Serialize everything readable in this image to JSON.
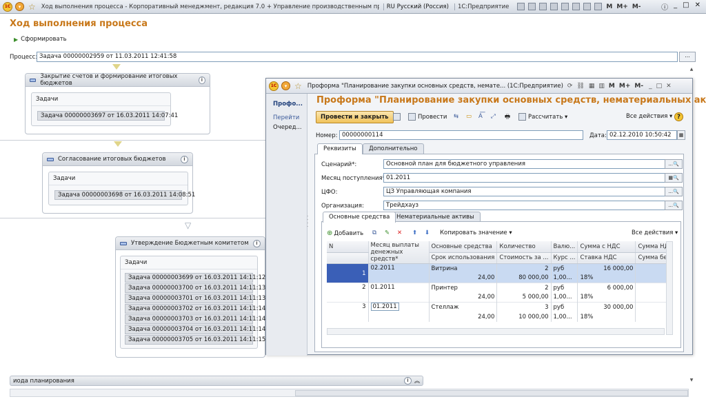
{
  "titlebar": {
    "title": "Ход выполнения процесса - Корпоративный менеджмент, редакция 7.0 + Управление производственным предприятием, ...",
    "lang": "RU Русский (Россия)",
    "app": "1С:Предприятие",
    "letters": [
      "M",
      "M+",
      "M-"
    ]
  },
  "page": {
    "title": "Ход выполнения процесса",
    "form_button": "Сформировать",
    "process_label": "Процесс:",
    "process_value": "Задача 00000002959 от 11.03.2011 12:41:58",
    "dots": "..."
  },
  "blocks": [
    {
      "title": "Закрытие счетов и формирование итоговых бюджетов",
      "tasks_label": "Задачи",
      "tasks": [
        "Задача 00000003697 от 16.03.2011 14:07:41"
      ]
    },
    {
      "title": "Согласование итоговых бюджетов",
      "tasks_label": "Задачи",
      "tasks": [
        "Задача 00000003698 от 16.03.2011 14:08:51"
      ]
    },
    {
      "title": "Утверждение Бюджетным комитетом",
      "tasks_label": "Задачи",
      "tasks": [
        "Задача 00000003699 от 16.03.2011 14:11:12",
        "Задача 00000003700 от 16.03.2011 14:11:13",
        "Задача 00000003701 от 16.03.2011 14:11:13",
        "Задача 00000003702 от 16.03.2011 14:11:14",
        "Задача 00000003703 от 16.03.2011 14:11:14",
        "Задача 00000003704 от 16.03.2011 14:11:14",
        "Задача 00000003705 от 16.03.2011 14:11:15"
      ]
    }
  ],
  "bottom_block": "иода планирования",
  "dialog": {
    "title": "Проформа \"Планирование закупки основных средств, немате... (1С:Предприятие)",
    "left_nav": [
      "Профо...",
      "Перейти",
      "Очеред..."
    ],
    "heading": "Проформа \"Планирование закупки основных средств, нематериальных актив...",
    "toolbar": {
      "post_close": "Провести и закрыть",
      "post": "Провести",
      "calculate": "Рассчитать",
      "all_actions": "Все действия",
      "help": "?"
    },
    "number_label": "Номер:",
    "number_value": "00000000114",
    "date_label": "Дата:",
    "date_value": "02.12.2010 10:50:42",
    "tabs": [
      "Реквизиты",
      "Дополнительно"
    ],
    "fields": [
      {
        "label": "Сценарий*:",
        "value": "Основной план для бюджетного управления"
      },
      {
        "label": "Месяц поступления*:",
        "value": "01.2011"
      },
      {
        "label": "ЦФО:",
        "value": "ЦЗ Управляющая компания"
      },
      {
        "label": "Организация:",
        "value": "Трейдхауз"
      }
    ],
    "subtabs": [
      "Основные средства",
      "Нематериальные активы"
    ],
    "grid_toolbar": {
      "add": "Добавить",
      "copy_value": "Копировать значение",
      "all_actions": "Все действия"
    },
    "grid_headers_top": [
      "N",
      "Месяц выплаты денежных средств*",
      "Основные средства",
      "Количество",
      "Валю...",
      "Сумма с НДС",
      "Сумма НДС"
    ],
    "grid_headers_bottom": [
      "",
      "",
      "Срок использования",
      "Стоимость за ...",
      "Курс ...",
      "Ставка НДС",
      "Сумма без НДС"
    ],
    "rows": [
      {
        "n": "1",
        "month": "02.2011",
        "asset": "Витрина",
        "term": "24,00",
        "qty": "2",
        "cost": "80 000,00",
        "cur": "руб",
        "rate": "1,00...",
        "sum": "16 000,00",
        "vat": "18%"
      },
      {
        "n": "2",
        "month": "01.2011",
        "asset": "Принтер",
        "term": "24,00",
        "qty": "2",
        "cost": "5 000,00",
        "cur": "руб",
        "rate": "1,00...",
        "sum": "6 000,00",
        "vat": "18%"
      },
      {
        "n": "3",
        "month": "01.2011",
        "asset": "Стеллаж",
        "term": "24,00",
        "qty": "3",
        "cost": "10 000,00",
        "cur": "руб",
        "rate": "1,00...",
        "sum": "30 000,00",
        "vat": "18%"
      }
    ]
  }
}
